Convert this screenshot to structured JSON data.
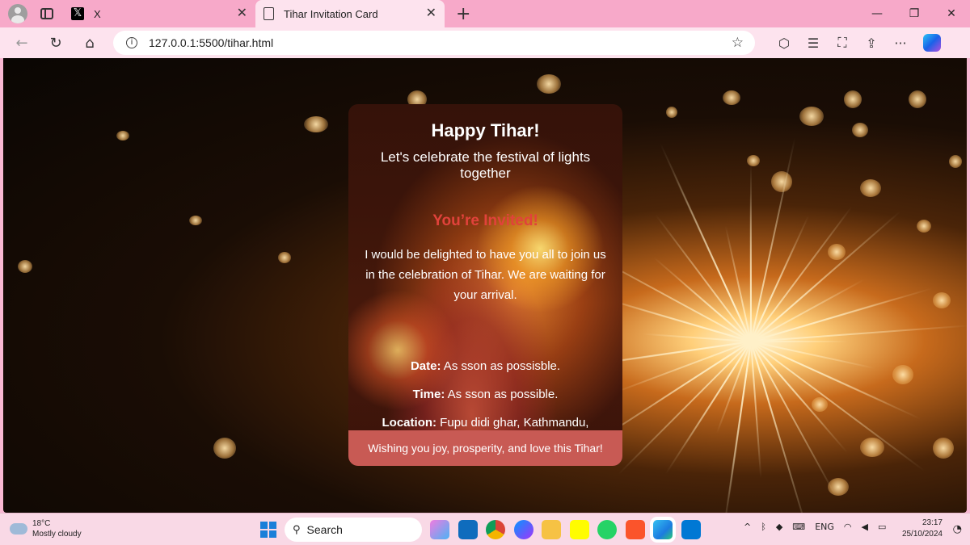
{
  "browser": {
    "tabs": [
      {
        "title": "X",
        "icon": "x-logo-icon"
      },
      {
        "title": "Tihar Invitation Card",
        "icon": "document-icon",
        "active": true
      }
    ],
    "url": "127.0.0.1:5500/tihar.html",
    "new_tab_symbol": "+"
  },
  "card": {
    "title": "Happy Tihar!",
    "subtitle": "Let's celebrate the festival of lights together",
    "invited": "You’re Invited!",
    "message": "I would be delighted to have you all to join us in the celebration of Tihar. We are waiting for your arrival.",
    "date_label": "Date:",
    "date_value": " As sson as possisble.",
    "time_label": "Time:",
    "time_value": " As sson as possible.",
    "location_label": "Location:",
    "location_value": " Fupu didi ghar, Kathmandu, Nepal",
    "footer": "Wishing you joy, prosperity, and love this Tihar!",
    "colors": {
      "invited": "#e1423b",
      "footer_bg": "#c85a54"
    }
  },
  "taskbar": {
    "weather_temp": "18°C",
    "weather_desc": "Mostly cloudy",
    "search_label": "Search",
    "language": "ENG",
    "time": "23:17",
    "date": "25/10/2024",
    "colors": {
      "background": "#f9d9e6",
      "chrome": "#f7a9c9"
    }
  }
}
